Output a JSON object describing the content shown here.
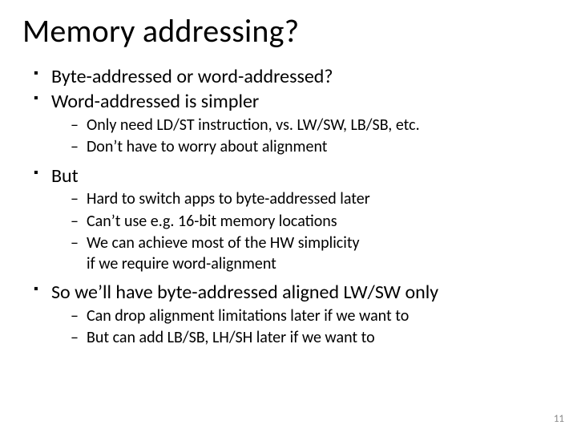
{
  "title": "Memory addressing?",
  "bullets": {
    "b1": "Byte-addressed or word-addressed?",
    "b2": "Word-addressed is simpler",
    "b2_sub": {
      "s1": "Only need LD/ST instruction, vs. LW/SW, LB/SB, etc.",
      "s2": "Don’t have to worry about alignment"
    },
    "b3": "But",
    "b3_sub": {
      "s1": "Hard to switch apps to byte-addressed later",
      "s2": "Can’t use e.g. 16-bit memory locations",
      "s3a": "We can achieve most of the HW simplicity",
      "s3b": "if we require word-alignment"
    },
    "b4": "So we’ll have byte-addressed aligned LW/SW only",
    "b4_sub": {
      "s1": "Can drop alignment limitations later if we want to",
      "s2": "But can add LB/SB, LH/SH later if we want to"
    }
  },
  "page_number": "11"
}
